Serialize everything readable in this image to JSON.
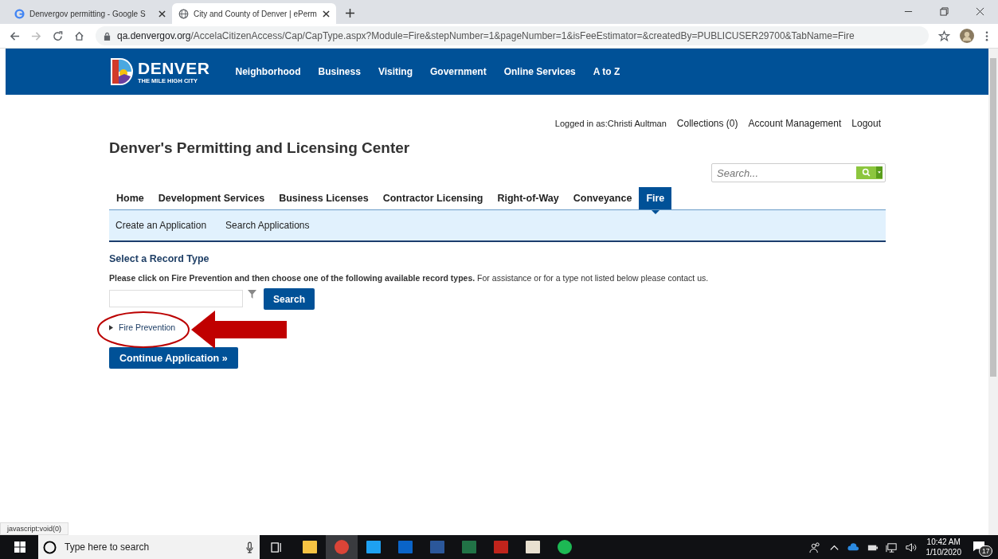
{
  "browser": {
    "tabs": [
      {
        "title": "Denvergov permitting - Google S",
        "kind": "google",
        "selected": false
      },
      {
        "title": "City and County of Denver | ePerm",
        "kind": "globe",
        "selected": true
      }
    ],
    "url_host": "qa.denvergov.org",
    "url_path": "/AccelaCitizenAccess/Cap/CapType.aspx?Module=Fire&stepNumber=1&pageNumber=1&isFeeEstimator=&createdBy=PUBLICUSER29700&TabName=Fire",
    "status_url": "javascript:void(0)"
  },
  "site_header": {
    "logo": {
      "name": "DENVER",
      "tagline": "THE MILE HIGH CITY"
    },
    "nav": [
      "Neighborhood",
      "Business",
      "Visiting",
      "Government",
      "Online Services",
      "A to Z"
    ]
  },
  "user_bar": {
    "logged_in": "Logged in as:Christi Aultman",
    "links": [
      "Collections (0)",
      "Account Management",
      "Logout"
    ]
  },
  "page_title": "Denver's Permitting and Licensing Center",
  "global_search": {
    "placeholder": "Search..."
  },
  "module_tabs": [
    {
      "label": "Home",
      "selected": false
    },
    {
      "label": "Development Services",
      "selected": false
    },
    {
      "label": "Business Licenses",
      "selected": false
    },
    {
      "label": "Contractor Licensing",
      "selected": false
    },
    {
      "label": "Right-of-Way",
      "selected": false
    },
    {
      "label": "Conveyance",
      "selected": false
    },
    {
      "label": "Fire",
      "selected": true
    }
  ],
  "sub_tabs": [
    "Create an Application",
    "Search Applications"
  ],
  "record_type": {
    "heading": "Select a Record Type",
    "instructions": "**Please click on Fire Prevention and then choose one of the following available record types.** For assistance or for a type not listed below please contact us.",
    "search_button": "Search",
    "tree": [
      {
        "label": "Fire Prevention",
        "expanded": false
      }
    ],
    "continue_button": "Continue Application »"
  },
  "taskbar": {
    "search_placeholder": "Type here to search",
    "time": "10:42 AM",
    "date": "1/10/2020",
    "notification_count": "17"
  }
}
